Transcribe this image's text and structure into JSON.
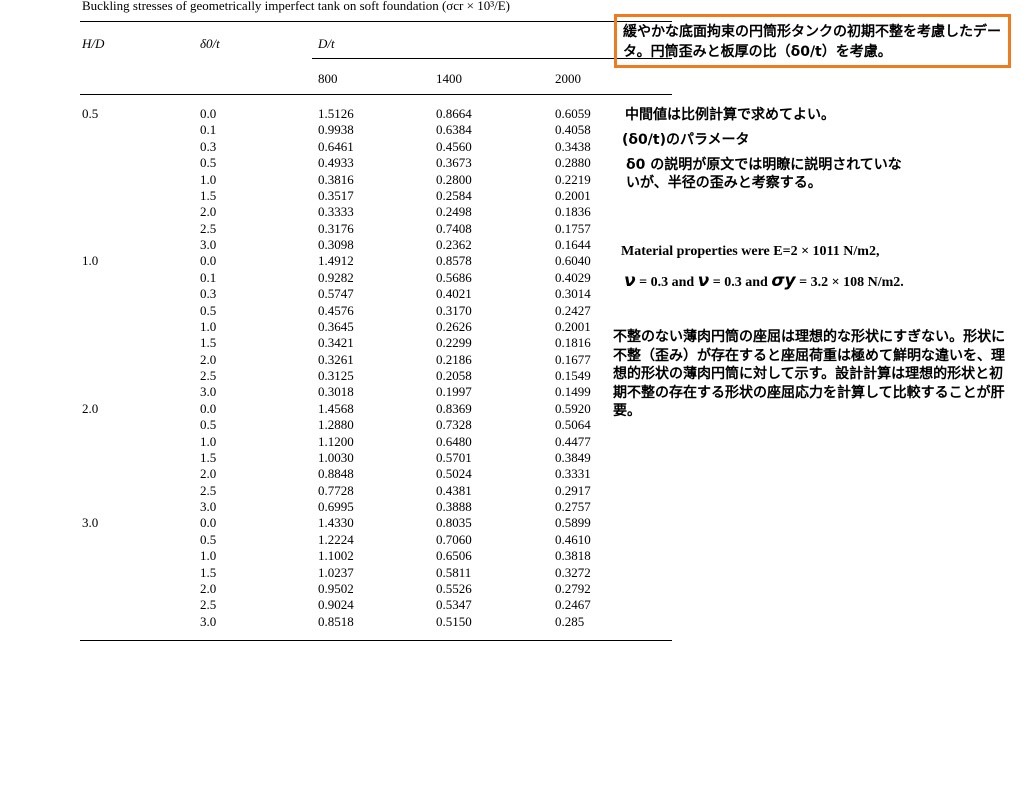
{
  "table": {
    "caption": "Buckling stresses of geometrically imperfect tank on soft foundation (σcr × 10³/E)",
    "headers": {
      "hd": "H/D",
      "delta": "δ0/t",
      "dt": "D/t",
      "dt_values": [
        "800",
        "1400",
        "2000"
      ]
    },
    "groups": [
      {
        "hd": "0.5",
        "rows": [
          [
            "0.0",
            "1.5126",
            "0.8664",
            "0.6059"
          ],
          [
            "0.1",
            "0.9938",
            "0.6384",
            "0.4058"
          ],
          [
            "0.3",
            "0.6461",
            "0.4560",
            "0.3438"
          ],
          [
            "0.5",
            "0.4933",
            "0.3673",
            "0.2880"
          ],
          [
            "1.0",
            "0.3816",
            "0.2800",
            "0.2219"
          ],
          [
            "1.5",
            "0.3517",
            "0.2584",
            "0.2001"
          ],
          [
            "2.0",
            "0.3333",
            "0.2498",
            "0.1836"
          ],
          [
            "2.5",
            "0.3176",
            "0.7408",
            "0.1757"
          ],
          [
            "3.0",
            "0.3098",
            "0.2362",
            "0.1644"
          ]
        ]
      },
      {
        "hd": "1.0",
        "rows": [
          [
            "0.0",
            "1.4912",
            "0.8578",
            "0.6040"
          ],
          [
            "0.1",
            "0.9282",
            "0.5686",
            "0.4029"
          ],
          [
            "0.3",
            "0.5747",
            "0.4021",
            "0.3014"
          ],
          [
            "0.5",
            "0.4576",
            "0.3170",
            "0.2427"
          ],
          [
            "1.0",
            "0.3645",
            "0.2626",
            "0.2001"
          ],
          [
            "1.5",
            "0.3421",
            "0.2299",
            "0.1816"
          ],
          [
            "2.0",
            "0.3261",
            "0.2186",
            "0.1677"
          ],
          [
            "2.5",
            "0.3125",
            "0.2058",
            "0.1549"
          ],
          [
            "3.0",
            "0.3018",
            "0.1997",
            "0.1499"
          ]
        ]
      },
      {
        "hd": "2.0",
        "rows": [
          [
            "0.0",
            "1.4568",
            "0.8369",
            "0.5920"
          ],
          [
            "0.5",
            "1.2880",
            "0.7328",
            "0.5064"
          ],
          [
            "1.0",
            "1.1200",
            "0.6480",
            "0.4477"
          ],
          [
            "1.5",
            "1.0030",
            "0.5701",
            "0.3849"
          ],
          [
            "2.0",
            "0.8848",
            "0.5024",
            "0.3331"
          ],
          [
            "2.5",
            "0.7728",
            "0.4381",
            "0.2917"
          ],
          [
            "3.0",
            "0.6995",
            "0.3888",
            "0.2757"
          ]
        ]
      },
      {
        "hd": "3.0",
        "rows": [
          [
            "0.0",
            "1.4330",
            "0.8035",
            "0.5899"
          ],
          [
            "0.5",
            "1.2224",
            "0.7060",
            "0.4610"
          ],
          [
            "1.0",
            "1.1002",
            "0.6506",
            "0.3818"
          ],
          [
            "1.5",
            "1.0237",
            "0.5811",
            "0.3272"
          ],
          [
            "2.0",
            "0.9502",
            "0.5526",
            "0.2792"
          ],
          [
            "2.5",
            "0.9024",
            "0.5347",
            "0.2467"
          ],
          [
            "3.0",
            "0.8518",
            "0.5150",
            "0.285"
          ]
        ]
      }
    ]
  },
  "annotations": {
    "box_note": "緩やかな底面拘束の円筒形タンクの初期不整を考慮したデータ。円筒歪みと板厚の比（δ0/t）を考慮。",
    "box_border_color": "#f07b1f",
    "note_interpolation": "中間値は比例計算で求めてよい。",
    "note_param": "(δ0/t)のパラメータ",
    "note_delta": "δ0 の説明が原文では明瞭に説明されていないが、半径の歪みと考察する。",
    "material_line1": "Material properties were E=2 × 1011 N/m2,",
    "material_nu1_symbol": "ν",
    "material_nu1_text": " = 0.3 and ",
    "material_nu2_symbol": "ν",
    "material_nu2_text": " = 0.3 and ",
    "material_sigma_symbol": "σy",
    "material_sigma_text": " = 3.2 × 108 N/m2.",
    "note_imperfection": "不整のない薄肉円筒の座屈は理想的な形状にすぎない。形状に不整（歪み）が存在すると座屈荷重は極めて鮮明な違いを、理想的形状の薄肉円筒に対して示す。設計計算は理想的形状と初期不整の存在する形状の座屈応力を計算して比較することが肝要。"
  }
}
